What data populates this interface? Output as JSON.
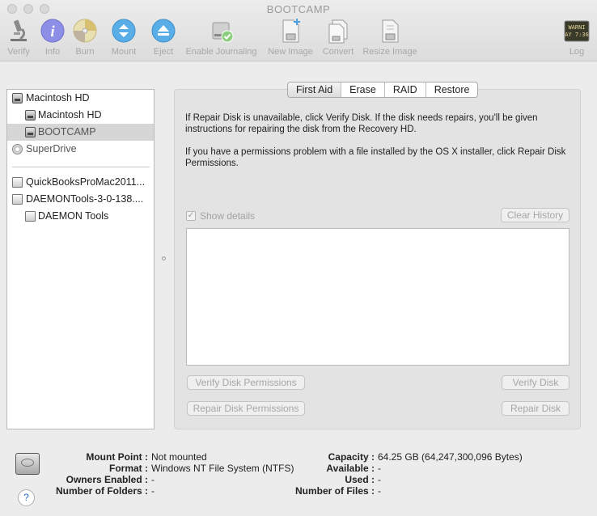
{
  "window": {
    "title": "BOOTCAMP"
  },
  "toolbar": {
    "verify": "Verify",
    "info": "Info",
    "burn": "Burn",
    "mount": "Mount",
    "eject": "Eject",
    "enable_journaling": "Enable Journaling",
    "new_image": "New Image",
    "convert": "Convert",
    "resize_image": "Resize Image",
    "log": "Log",
    "log_icon_text": [
      "WARNI",
      "AY 7:36"
    ]
  },
  "sidebar": {
    "items": [
      {
        "label": "Macintosh HD",
        "icon": "hard-disk-icon"
      },
      {
        "label": "Macintosh HD",
        "icon": "volume-icon"
      },
      {
        "label": "BOOTCAMP",
        "icon": "volume-icon",
        "selected": true
      },
      {
        "label": "SuperDrive",
        "icon": "optical-drive-icon"
      },
      {
        "label": "QuickBooksProMac2011...",
        "icon": "disk-image-icon"
      },
      {
        "label": "DAEMONTools-3-0-138....",
        "icon": "disk-image-icon"
      },
      {
        "label": "DAEMON Tools",
        "icon": "mounted-volume-icon"
      }
    ]
  },
  "tabs": [
    "First Aid",
    "Erase",
    "RAID",
    "Restore"
  ],
  "first_aid": {
    "desc1": "If Repair Disk is unavailable, click Verify Disk. If the disk needs repairs, you'll be given instructions for repairing the disk from the Recovery HD.",
    "desc2": "If you have a permissions problem with a file installed by the OS X installer, click Repair Disk Permissions.",
    "show_details": "Show details",
    "clear_history": "Clear History",
    "verify_permissions": "Verify Disk Permissions",
    "repair_permissions": "Repair Disk Permissions",
    "verify_disk": "Verify Disk",
    "repair_disk": "Repair Disk"
  },
  "info": {
    "mount_point_key": "Mount Point :",
    "mount_point": "Not mounted",
    "format_key": "Format :",
    "format": "Windows NT File System (NTFS)",
    "owners_key": "Owners Enabled :",
    "owners": "-",
    "folders_key": "Number of Folders :",
    "folders": "-",
    "capacity_key": "Capacity :",
    "capacity": "64.25 GB (64,247,300,096 Bytes)",
    "available_key": "Available :",
    "available": "-",
    "used_key": "Used :",
    "used": "-",
    "files_key": "Number of Files :",
    "files": "-",
    "help": "?"
  }
}
